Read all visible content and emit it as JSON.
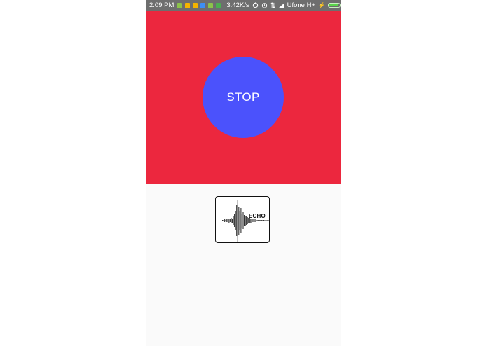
{
  "status_bar": {
    "time": "2:09 PM",
    "notification_icons": [
      {
        "name": "android-icon",
        "color": "#8bc34a"
      },
      {
        "name": "app-notification-icon",
        "color": "#f5b400"
      },
      {
        "name": "app-notification-icon",
        "color": "#f5b400"
      },
      {
        "name": "messenger-icon",
        "color": "#3d8ff5"
      },
      {
        "name": "lock-icon",
        "color": "#8bc34a"
      },
      {
        "name": "android-icon",
        "color": "#4caf50"
      }
    ],
    "network_speed": "3.42K/s",
    "carrier": "Ufone H+",
    "battery_level": 0.95
  },
  "main": {
    "background_color": "#ec273e",
    "button_color": "#4b52fc",
    "stop_label": "STOP"
  },
  "logo": {
    "text": "ECHO"
  }
}
